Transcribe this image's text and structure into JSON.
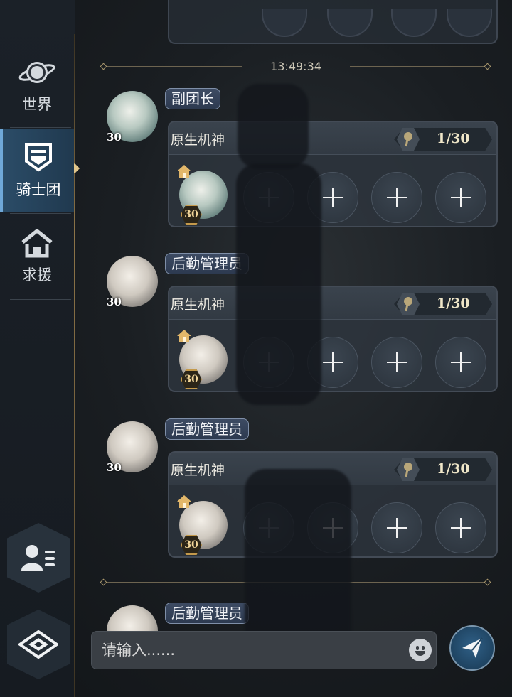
{
  "sidebar": {
    "items": [
      {
        "label": "世界",
        "icon": "planet-icon",
        "active": false
      },
      {
        "label": "骑士团",
        "icon": "shield-icon",
        "active": true
      },
      {
        "label": "求援",
        "icon": "home-icon",
        "active": false
      }
    ],
    "bottom_buttons": [
      {
        "icon": "contacts-icon"
      },
      {
        "icon": "emblem-icon"
      }
    ]
  },
  "chat": {
    "timestamp": "13:49:34",
    "messages": [
      {
        "sender_title": "副团长",
        "sender_level": "30",
        "card_name": "原生机神",
        "count": "1/30",
        "owner_level": "30",
        "slots": 4
      },
      {
        "sender_title": "后勤管理员",
        "sender_level": "30",
        "card_name": "原生机神",
        "count": "1/30",
        "owner_level": "30",
        "slots": 4
      },
      {
        "sender_title": "后勤管理员",
        "sender_level": "30",
        "card_name": "原生机神",
        "count": "1/30",
        "owner_level": "30",
        "slots": 4
      },
      {
        "sender_title": "后勤管理员",
        "sender_level": "",
        "card_name": "",
        "count": "",
        "owner_level": "",
        "slots": 0
      }
    ]
  },
  "input": {
    "placeholder": "请输入......",
    "value": ""
  },
  "colors": {
    "accent_gold": "#c59a4b",
    "active_tab": "#2b4c67",
    "send_button": "#2f5f86"
  }
}
